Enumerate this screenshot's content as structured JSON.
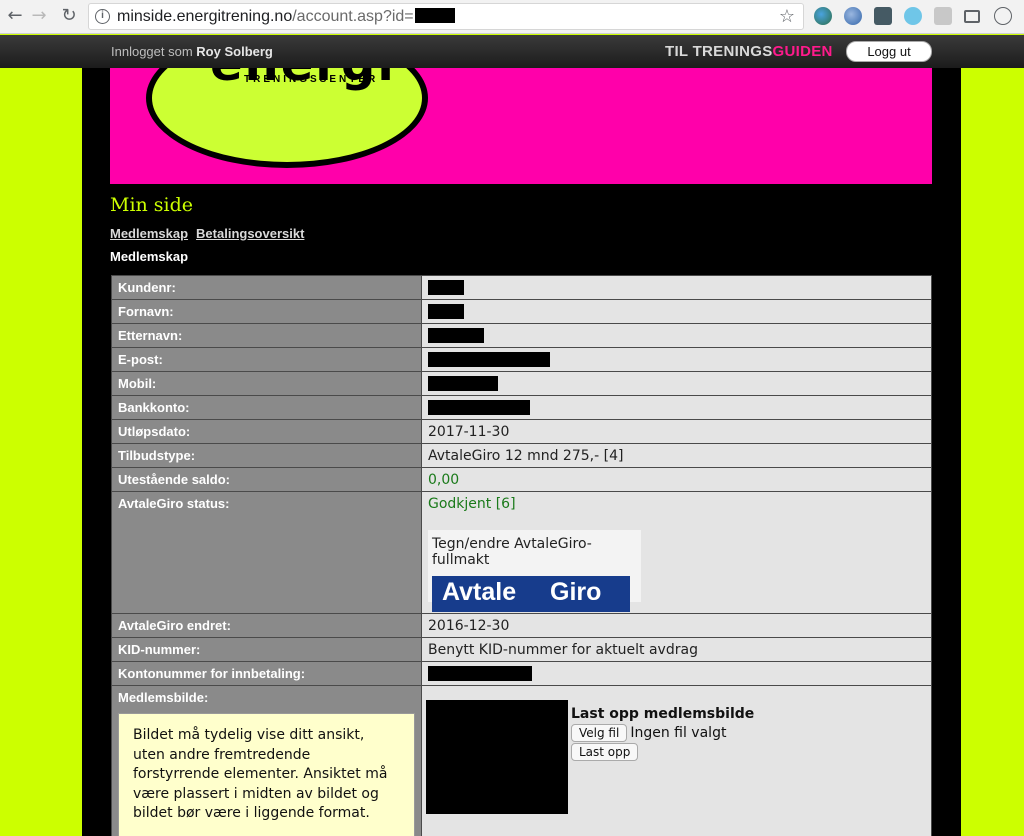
{
  "browser": {
    "url_host": "minside.energitrening.no",
    "url_path": "/account.asp?id=",
    "nav": {
      "back": "←",
      "forward": "→",
      "reload": "↻"
    },
    "info_icon": "i",
    "star_icon": "☆"
  },
  "topbar": {
    "logged_in_prefix": "Innlogget som",
    "user_name": "Roy Solberg",
    "guide_prefix": "TIL TRENINGS",
    "guide_suffix": "GUIDEN",
    "logout_label": "Logg ut"
  },
  "banner": {
    "logo_text": "energi",
    "logo_sub": "TRENINGSSENTER"
  },
  "page": {
    "title": "Min side",
    "tabs": [
      {
        "label": "Medlemskap"
      },
      {
        "label": "Betalingsoversikt"
      }
    ],
    "section_title": "Medlemskap"
  },
  "membership": {
    "kundenr": {
      "label": "Kundenr:"
    },
    "fornavn": {
      "label": "Fornavn:"
    },
    "etternavn": {
      "label": "Etternavn:"
    },
    "epost": {
      "label": "E-post:"
    },
    "mobil": {
      "label": "Mobil:"
    },
    "bankkonto": {
      "label": "Bankkonto:"
    },
    "utlopsdato": {
      "label": "Utløpsdato:",
      "value": "2017-11-30"
    },
    "tilbudstype": {
      "label": "Tilbudstype:",
      "value": "AvtaleGiro 12 mnd 275,- [4]"
    },
    "saldo": {
      "label": "Utestående saldo:",
      "value": "0,00"
    },
    "ag_status": {
      "label": "AvtaleGiro status:",
      "value": "Godkjent [6]",
      "mandate_text": "Tegn/endre AvtaleGiro-fullmakt",
      "logo_left": "Avtale",
      "logo_right": "Giro"
    },
    "ag_endret": {
      "label": "AvtaleGiro endret:",
      "value": "2016-12-30"
    },
    "kid": {
      "label": "KID-nummer:",
      "value": "Benytt KID-nummer for aktuelt avdrag"
    },
    "kontonummer": {
      "label": "Kontonummer for innbetaling:"
    },
    "bilde": {
      "label": "Medlemsbilde:",
      "tip": "Bildet må tydelig vise ditt ansikt, uten andre fremtredende forstyrrende elementer. Ansiktet må være plassert i midten av bildet og bildet bør være i liggende format.",
      "upload_title": "Last opp medlemsbilde",
      "choose_file": "Velg fil",
      "no_file": "Ingen fil valgt",
      "upload_button": "Last opp"
    }
  },
  "colors": {
    "page_background": "#ccff00",
    "banner": "#ff00aa",
    "label_cell": "#8a8a8a",
    "value_cell": "#e4e4e4",
    "positive_value": "#1a7a1a",
    "avtalegiro_blue": "#173c8c"
  }
}
